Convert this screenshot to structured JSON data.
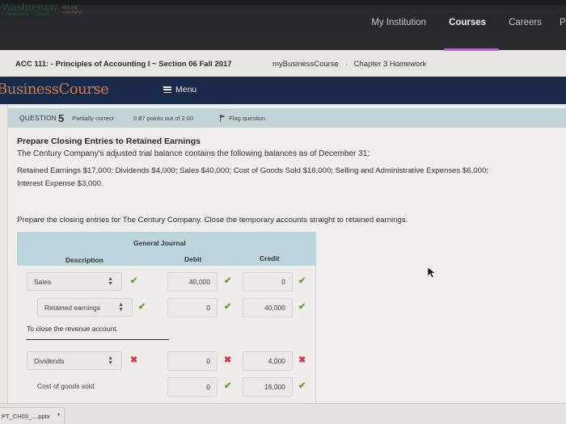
{
  "institution": {
    "logo_name": "Washtenaw",
    "logo_sub": "Community College",
    "logo_tag_1": "ONLINE",
    "logo_tag_2": "LEARNING",
    "nav": [
      "My Institution",
      "Courses",
      "Careers",
      "P"
    ],
    "active_nav": "Courses"
  },
  "course": {
    "title": "ACC 111: - Principles of Accounting I ~ Section 06 Fall 2017",
    "breadcrumb": [
      "myBusinessCourse",
      "Chapter 3 Homework"
    ],
    "breadcrumb_sep": "›"
  },
  "banner": {
    "brand": "BusinessCourse",
    "menu_label": "Menu"
  },
  "question": {
    "label": "QUESTION",
    "number": "5",
    "status": "Partially correct",
    "points": "0.87 points out of 2.00",
    "flag_label": "Flag question",
    "title": "Prepare Closing Entries to Retained Earnings",
    "intro": "The Century Company's adjusted trial balance contains the following balances as of December 31:",
    "balances_line1": "Retained Earnings $17,000; Dividends $4,000; Sales $40,000; Cost of Goods Sold $16,000; Selling and Administrative Expenses $6,000;",
    "balances_line2": "Interest Expense $3,000.",
    "instruction": "Prepare the closing entries for The Century Company. Close the temporary accounts straight to retained earnings."
  },
  "journal": {
    "title": "General Journal",
    "columns": [
      "Description",
      "Debit",
      "Credit"
    ],
    "rows": [
      {
        "description": "Sales",
        "type": "select",
        "desc_status": "correct",
        "debit": "40,000",
        "debit_status": "correct",
        "credit": "0",
        "credit_status": "correct"
      },
      {
        "description": "Retained earnings",
        "type": "select",
        "desc_status": "correct",
        "debit": "0",
        "debit_status": "correct",
        "credit": "40,000",
        "credit_status": "correct"
      },
      {
        "description": "Dividends",
        "type": "select",
        "desc_status": "incorrect",
        "debit": "0",
        "debit_status": "incorrect",
        "credit": "4,000",
        "credit_status": "incorrect"
      },
      {
        "description": "Cost of goods sold",
        "type": "text",
        "desc_status": "",
        "debit": "0",
        "debit_status": "correct",
        "credit": "16,000",
        "credit_status": "correct"
      }
    ],
    "memo": "To close the revenue account."
  },
  "status_icons": {
    "correct": "✔",
    "incorrect": "✖"
  },
  "colors": {
    "correct": "#55a030",
    "incorrect": "#d9364a",
    "banner": "#19294a",
    "brand": "#d77d43",
    "table_header": "#bdd6db"
  },
  "downloads": {
    "file": "PT_CH03_....pptx",
    "caret": "▾"
  }
}
